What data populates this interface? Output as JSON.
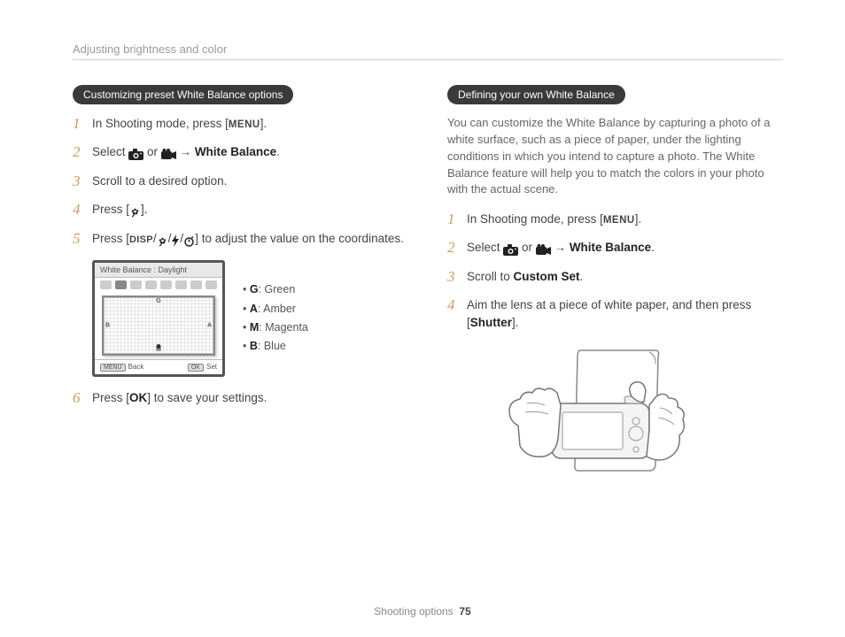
{
  "header": {
    "section": "Adjusting brightness and color"
  },
  "left": {
    "pill": "Customizing preset White Balance options",
    "steps": {
      "s1a": "In Shooting mode, press [",
      "s1b": "].",
      "s2a": "Select ",
      "s2b": " or ",
      "s2c": " → ",
      "s2d": "White Balance",
      "s2e": ".",
      "s3": "Scroll to a desired option.",
      "s4a": "Press [",
      "s4b": "].",
      "s5a": "Press [",
      "s5b": "/",
      "s5c": "/",
      "s5d": "/",
      "s5e": "] to adjust the value on the coordinates.",
      "s6a": "Press [",
      "s6b": "] to save your settings."
    },
    "menu": "MENU",
    "disp": "DISP",
    "ok": "OK",
    "lcd": {
      "title": "White Balance : Daylight",
      "g": "G",
      "a": "A",
      "m": "M",
      "b": "B",
      "back": "Back",
      "set": "Set",
      "menuBtn": "MENU",
      "okBtn": "OK"
    },
    "legend": {
      "g1": "G",
      "g2": ": Green",
      "a1": "A",
      "a2": ": Amber",
      "m1": "M",
      "m2": ": Magenta",
      "b1": "B",
      "b2": ": Blue"
    }
  },
  "right": {
    "pill": "Defining your own White Balance",
    "intro": "You can customize the White Balance by capturing a photo of a white surface, such as a piece of paper, under the lighting conditions in which you intend to capture a photo. The White Balance feature will help you to match the colors in your photo with the actual scene.",
    "steps": {
      "s1a": "In Shooting mode, press [",
      "s1b": "].",
      "s2a": "Select ",
      "s2b": " or ",
      "s2c": " → ",
      "s2d": "White Balance",
      "s2e": ".",
      "s3a": "Scroll to ",
      "s3b": "Custom Set",
      "s3c": ".",
      "s4a": "Aim the lens at a piece of white paper, and then press [",
      "s4b": "Shutter",
      "s4c": "]."
    },
    "menu": "MENU"
  },
  "footer": {
    "label": "Shooting options",
    "page": "75"
  }
}
